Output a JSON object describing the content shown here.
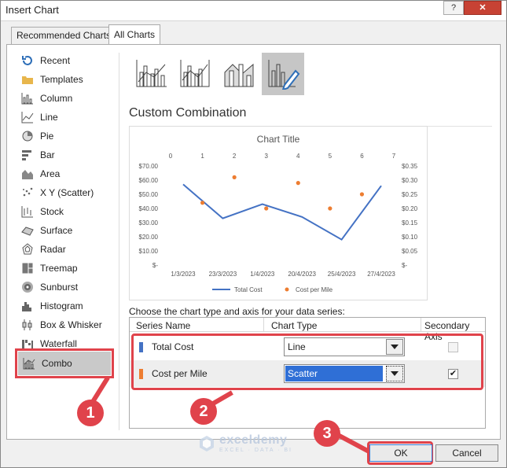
{
  "window": {
    "title": "Insert Chart",
    "help": "?",
    "close": "✕"
  },
  "tabs": [
    {
      "label": "Recommended Charts",
      "active": false
    },
    {
      "label": "All Charts",
      "active": true
    }
  ],
  "categories": [
    {
      "label": "Recent",
      "icon": "recent-icon"
    },
    {
      "label": "Templates",
      "icon": "folder-icon"
    },
    {
      "label": "Column",
      "icon": "column-chart-icon"
    },
    {
      "label": "Line",
      "icon": "line-chart-icon"
    },
    {
      "label": "Pie",
      "icon": "pie-chart-icon"
    },
    {
      "label": "Bar",
      "icon": "bar-chart-icon"
    },
    {
      "label": "Area",
      "icon": "area-chart-icon"
    },
    {
      "label": "X Y (Scatter)",
      "icon": "scatter-chart-icon"
    },
    {
      "label": "Stock",
      "icon": "stock-chart-icon"
    },
    {
      "label": "Surface",
      "icon": "surface-chart-icon"
    },
    {
      "label": "Radar",
      "icon": "radar-chart-icon"
    },
    {
      "label": "Treemap",
      "icon": "treemap-chart-icon"
    },
    {
      "label": "Sunburst",
      "icon": "sunburst-chart-icon"
    },
    {
      "label": "Histogram",
      "icon": "histogram-chart-icon"
    },
    {
      "label": "Box & Whisker",
      "icon": "box-whisker-chart-icon"
    },
    {
      "label": "Waterfall",
      "icon": "waterfall-chart-icon"
    },
    {
      "label": "Combo",
      "icon": "combo-chart-icon",
      "selected": true
    }
  ],
  "subtypes": [
    {
      "icon": "clustered-column-line-icon"
    },
    {
      "icon": "clustered-column-line-secondary-icon"
    },
    {
      "icon": "stacked-area-column-icon"
    },
    {
      "icon": "custom-combination-icon",
      "selected": true
    }
  ],
  "panel": {
    "heading": "Custom Combination",
    "choose_label": "Choose the chart type and axis for your data series:"
  },
  "chart_data": {
    "type": "line",
    "title": "Chart Title",
    "categories": [
      "1/3/2023",
      "23/3/2023",
      "1/4/2023",
      "20/4/2023",
      "25/4/2023",
      "27/4/2023"
    ],
    "y_ticks": [
      "$70.00",
      "$60.00",
      "$50.00",
      "$40.00",
      "$30.00",
      "$20.00",
      "$10.00",
      "$-"
    ],
    "y2_ticks": [
      "$0.35",
      "$0.30",
      "$0.25",
      "$0.20",
      "$0.15",
      "$0.10",
      "$0.05",
      "$-"
    ],
    "x2_ticks": [
      "0",
      "1",
      "2",
      "3",
      "4",
      "5",
      "6",
      "7"
    ],
    "ylim": [
      0,
      70
    ],
    "y2lim": [
      0,
      0.35
    ],
    "x2lim": [
      0,
      7
    ],
    "series": [
      {
        "name": "Total Cost",
        "kind": "line",
        "color": "#4472c4",
        "values": [
          57,
          33,
          43,
          34,
          18,
          56
        ]
      },
      {
        "name": "Cost per Mile",
        "kind": "scatter",
        "color": "#ed7d31",
        "x": [
          1,
          2,
          3,
          4,
          5,
          6
        ],
        "y": [
          0.22,
          0.31,
          0.2,
          0.29,
          0.2,
          0.25
        ]
      }
    ],
    "legend": "bottom"
  },
  "grid": {
    "col_series": "Series Name",
    "col_type": "Chart Type",
    "col_axis": "Secondary Axis",
    "rows": [
      {
        "name": "Total Cost",
        "color": "#4472c4",
        "type": "Line",
        "secondary": false
      },
      {
        "name": "Cost per Mile",
        "color": "#ed7d31",
        "type": "Scatter",
        "secondary": true
      }
    ]
  },
  "buttons": {
    "ok": "OK",
    "cancel": "Cancel"
  },
  "callouts": [
    "1",
    "2",
    "3"
  ],
  "watermark": {
    "name": "exceldemy",
    "sub": "EXCEL · DATA · BI"
  },
  "accent": "#e0434b"
}
